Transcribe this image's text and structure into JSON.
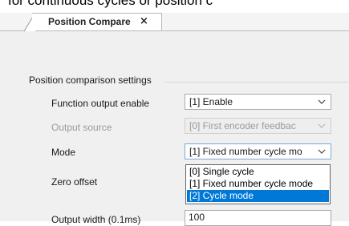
{
  "overflow_text": "for continuous cycles or position c",
  "tab": {
    "label": "Position Compare",
    "close_glyph": "×"
  },
  "section": {
    "title": "Position comparison settings"
  },
  "fields": {
    "function_output": {
      "label": "Function output enable",
      "value": "[1] Enable"
    },
    "output_source": {
      "label": "Output source",
      "value": "[0] First encoder feedbac"
    },
    "mode": {
      "label": "Mode",
      "value": "[1] Fixed number cycle mo"
    },
    "zero_offset": {
      "label": "Zero offset"
    },
    "output_width": {
      "label": "Output width (0.1ms)",
      "value": "100"
    }
  },
  "mode_dropdown": {
    "options": [
      {
        "label": "[0] Single cycle",
        "selected": false
      },
      {
        "label": "[1] Fixed number cycle mode",
        "selected": false
      },
      {
        "label": "[2] Cycle mode",
        "selected": true
      }
    ]
  },
  "colors": {
    "selection": "#0078d7",
    "panel": "#f0f0f0",
    "disabled_text": "#9a9a9a"
  },
  "icons": [
    "chevron-down-icon",
    "close-icon"
  ]
}
